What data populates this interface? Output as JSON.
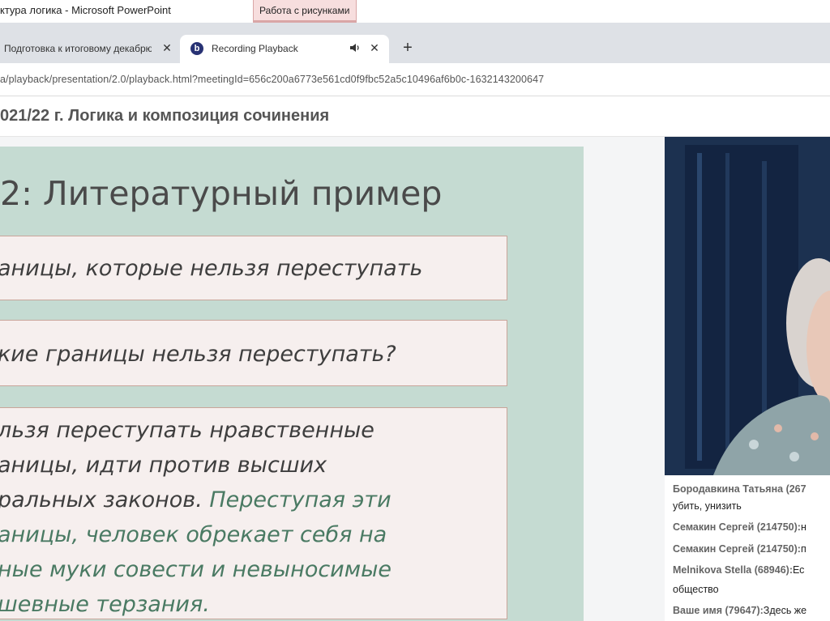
{
  "powerpoint": {
    "title": "ктура логика - Microsoft PowerPoint",
    "context_tab": "Работа с рисунками"
  },
  "browser": {
    "tabs": [
      {
        "label": "Подготовка к итоговому декабрю",
        "active": false
      },
      {
        "label": "Recording Playback",
        "active": true,
        "favicon": "b",
        "audio": true
      }
    ],
    "close_symbol": "✕",
    "new_tab_symbol": "+",
    "url": "a/playback/presentation/2.0/playback.html?meetingId=656c200a6773e561cd0f9fbc52a5c10496af6b0c-1632143200647"
  },
  "page": {
    "heading": "021/22 г. Логика и композиция сочинения"
  },
  "slide": {
    "title": "2: Литературный пример",
    "box1": "аницы, которые нельзя переступать",
    "box2": "кие границы нельзя переступать?",
    "box3": {
      "line1": "льзя переступать нравственные",
      "line2": "аницы, идти против высших",
      "line3_plain": "ральных законов. ",
      "line3_green": "Переступая эти",
      "line4": "аницы, человек обрекает себя на",
      "line5": "ные муки совести и невыносимые",
      "line6": "шевные терзания."
    },
    "colors": {
      "background": "#c5dbd2",
      "box": "#f6efee",
      "accent_text": "#4a7a63"
    }
  },
  "chat": {
    "messages": [
      {
        "name": "Бородавкина Татьяна (267",
        "text": ""
      },
      {
        "name": "",
        "text": "убить, унизить"
      },
      {
        "name": "Семакин Сергей (214750):",
        "text": "н"
      },
      {
        "name": "Семакин Сергей (214750):",
        "text": "п"
      },
      {
        "name": "Melnikova Stella (68946):",
        "text": "Ес"
      },
      {
        "name": "",
        "text": "общество"
      },
      {
        "name": "Ваше имя (79647):",
        "text": "Здесь же"
      }
    ]
  }
}
